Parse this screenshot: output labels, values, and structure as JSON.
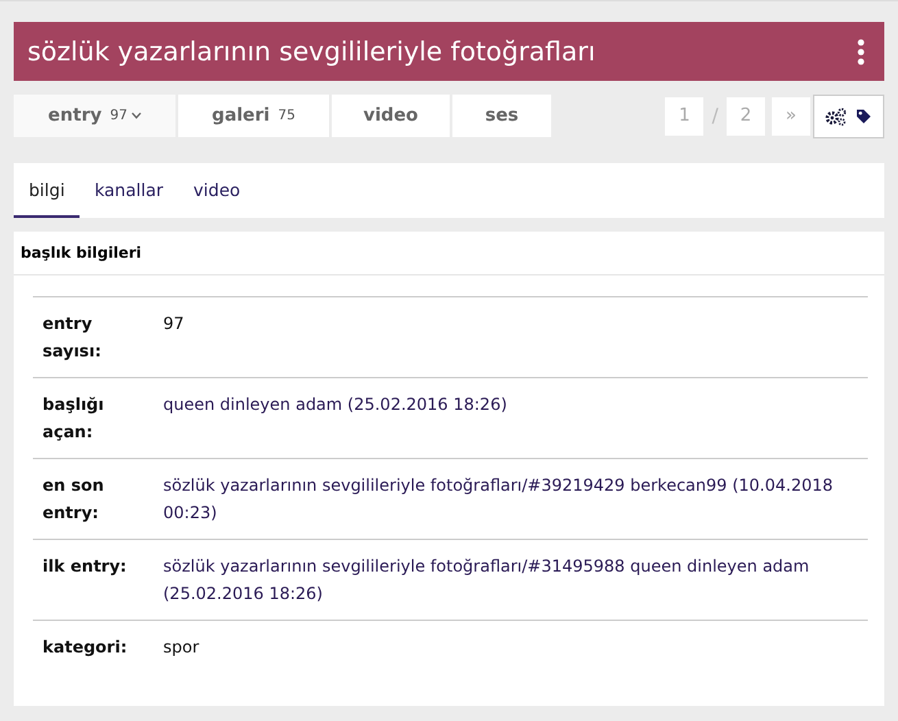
{
  "title": "sözlük yazarlarının sevgilileriyle fotoğrafları",
  "nav": [
    {
      "label": "entry",
      "count": "97",
      "dropdown": true
    },
    {
      "label": "galeri",
      "count": "75",
      "dropdown": false
    },
    {
      "label": "video",
      "dropdown": false
    },
    {
      "label": "ses",
      "dropdown": false
    }
  ],
  "pager": {
    "current": "1",
    "separator": "/",
    "total": "2",
    "next": "»"
  },
  "tabs": [
    {
      "label": "bilgi",
      "selected": true
    },
    {
      "label": "kanallar",
      "selected": false
    },
    {
      "label": "video",
      "selected": false
    }
  ],
  "section_title": "başlık bilgileri",
  "rows": [
    {
      "label": "entry sayısı:",
      "value": "97",
      "kind": "text"
    },
    {
      "label": "başlığı açan:",
      "value": "queen dinleyen adam (25.02.2016 18:26)",
      "kind": "link"
    },
    {
      "label": "en son entry:",
      "value": "sözlük yazarlarının sevgilileriyle fotoğrafları/#39219429 berkecan99 (10.04.2018 00:23)",
      "kind": "link"
    },
    {
      "label": "ilk entry:",
      "value": "sözlük yazarlarının sevgilileriyle fotoğrafları/#31495988 queen dinleyen adam (25.02.2016 18:26)",
      "kind": "link"
    },
    {
      "label": "kategori:",
      "value": "spor",
      "kind": "text"
    }
  ]
}
